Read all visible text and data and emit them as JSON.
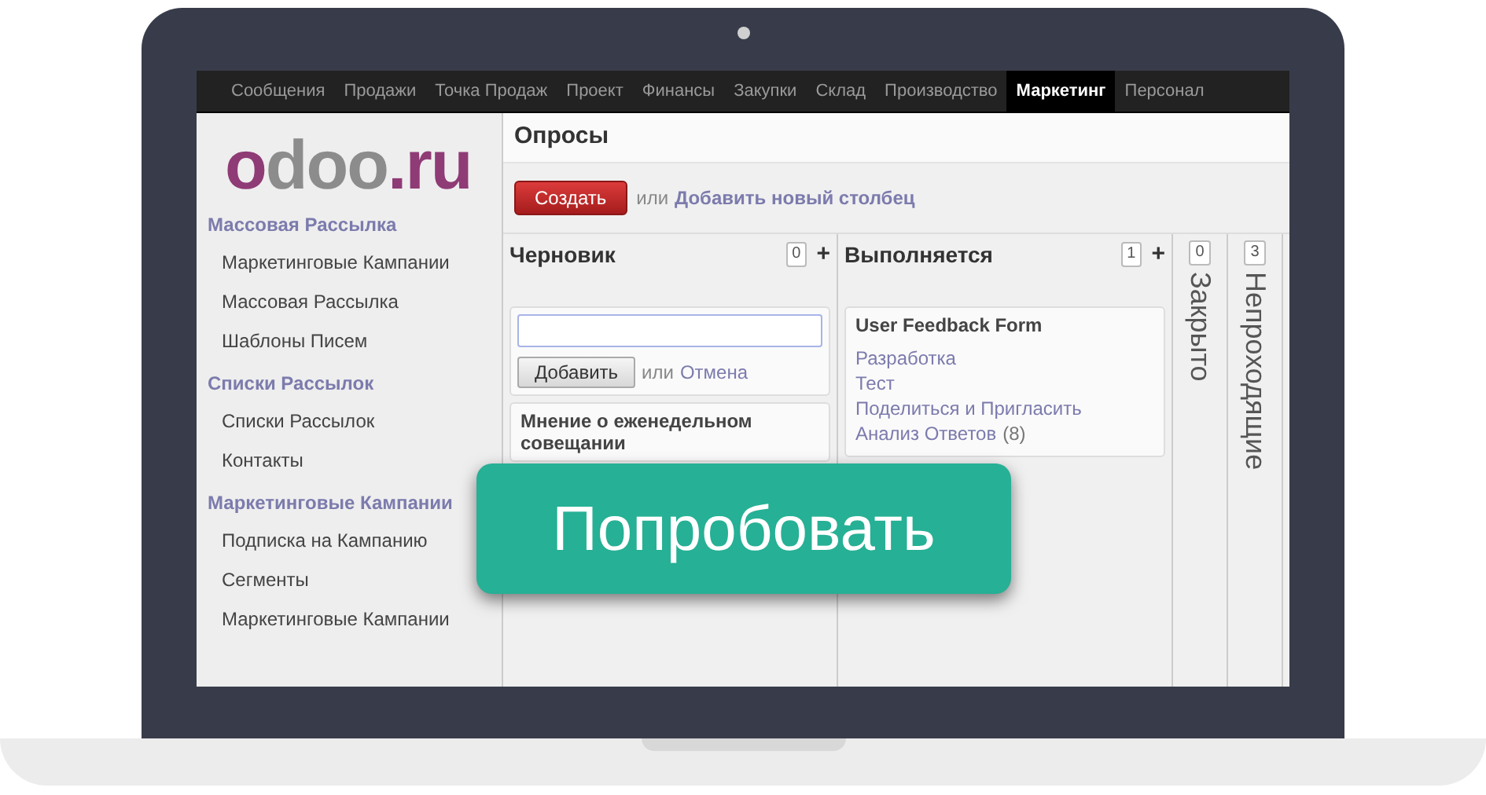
{
  "nav": [
    {
      "label": "Сообщения",
      "selected": false
    },
    {
      "label": "Продажи",
      "selected": false
    },
    {
      "label": "Точка Продаж",
      "selected": false
    },
    {
      "label": "Проект",
      "selected": false
    },
    {
      "label": "Финансы",
      "selected": false
    },
    {
      "label": "Закупки",
      "selected": false
    },
    {
      "label": "Склад",
      "selected": false
    },
    {
      "label": "Производство",
      "selected": false
    },
    {
      "label": "Маркетинг",
      "selected": true
    },
    {
      "label": "Персонал",
      "selected": false
    }
  ],
  "logo": [
    {
      "text": "o",
      "color": "#8f3b76"
    },
    {
      "text": "doo",
      "color": "#8c8c8c"
    },
    {
      "text": ".ru",
      "color": "#8f3b76"
    }
  ],
  "sidebar": [
    {
      "title": "Массовая Рассылка",
      "items": [
        "Маркетинговые Кампании",
        "Массовая Рассылка",
        "Шаблоны Писем"
      ]
    },
    {
      "title": "Списки Рассылок",
      "items": [
        "Списки Рассылок",
        "Контакты"
      ]
    },
    {
      "title": "Маркетинговые Кампании",
      "items": [
        "Подписка на Кампанию",
        "Сегменты",
        "Маркетинговые Кампании"
      ]
    }
  ],
  "title": "Опросы",
  "toolbar": {
    "create": "Создать",
    "or": "или",
    "add_column": "Добавить новый столбец"
  },
  "columns": [
    {
      "kind": "open",
      "title": "Черновик",
      "count": "0",
      "plus": "+",
      "quick_create": {
        "button": "Добавить",
        "or": "или",
        "cancel": "Отмена"
      },
      "cards": [
        {
          "title": "Мнение о еженедельном совещании"
        }
      ]
    },
    {
      "kind": "open",
      "title": "Выполняется",
      "count": "1",
      "plus": "+",
      "cards": [
        {
          "title": "User Feedback Form",
          "links": [
            "Разработка",
            "Тест",
            "Поделиться и Пригласить",
            "Анализ Ответов"
          ],
          "note": "(8)"
        }
      ]
    },
    {
      "kind": "folded",
      "title": "Закрыто",
      "count": "0"
    },
    {
      "kind": "folded",
      "title": "Непроходящие",
      "count": "3"
    }
  ],
  "cta": "Попробовать"
}
